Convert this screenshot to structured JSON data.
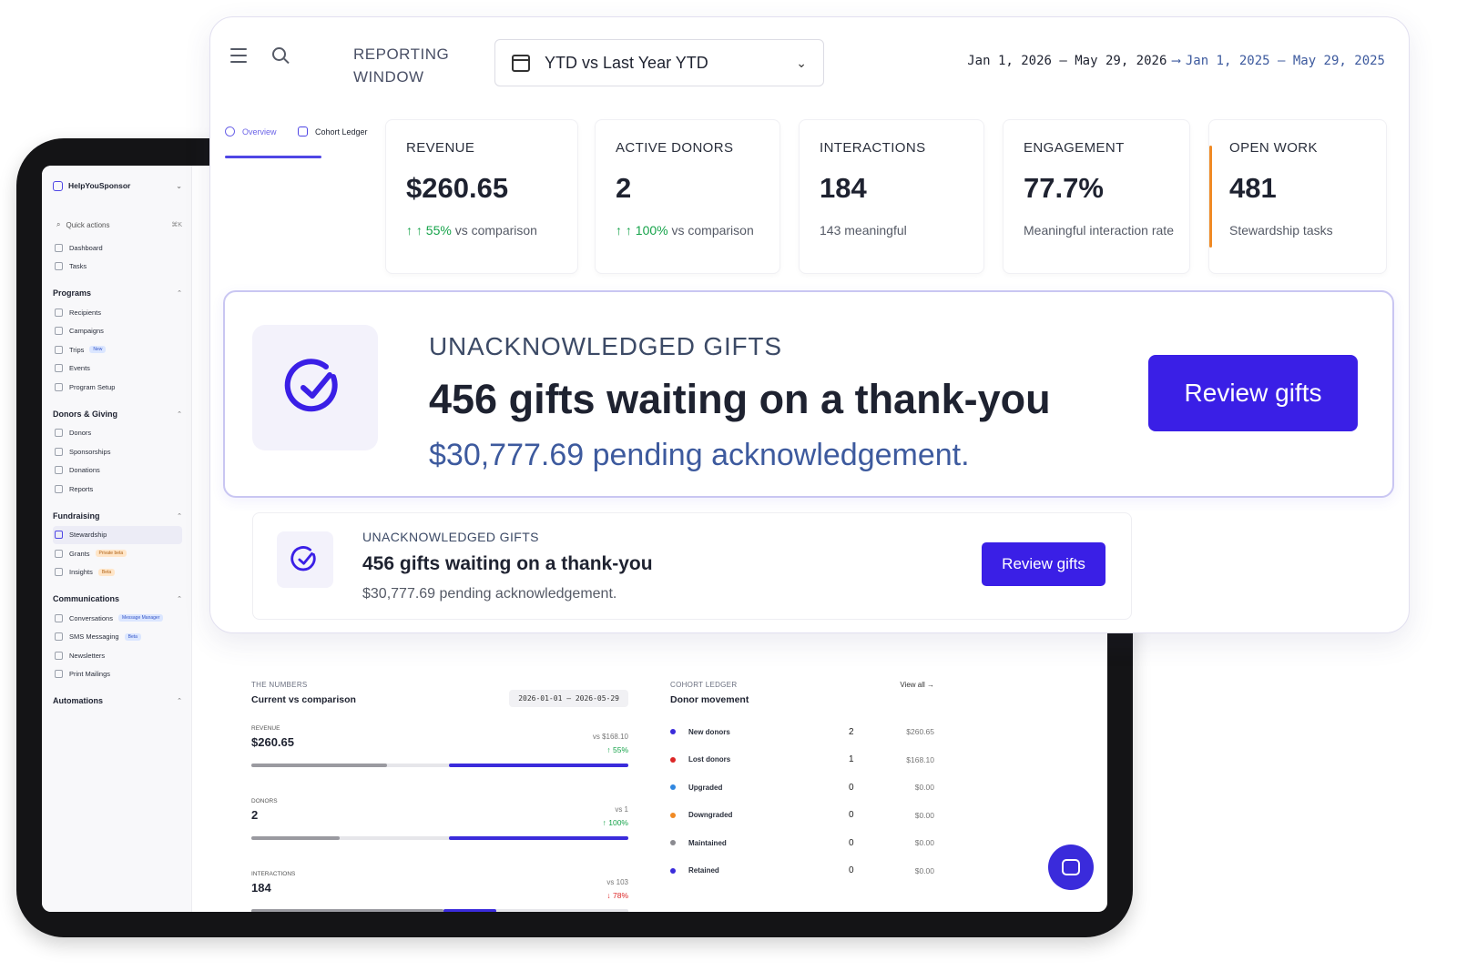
{
  "colors": {
    "accent": "#3a1fe6",
    "up": "#16a34a",
    "down": "#dc2626",
    "open_work_bar": "#f08a24"
  },
  "header": {
    "reporting_window_label": "REPORTING WINDOW",
    "selected_period": "YTD vs Last Year YTD",
    "current_range": "Jan 1, 2026 – May 29, 2026",
    "comparison_range": "Jan 1, 2025 – May 29, 2025"
  },
  "tabs": [
    {
      "label": "Overview",
      "icon": "check-circle-icon",
      "active": true
    },
    {
      "label": "Cohort Ledger",
      "icon": "ledger-icon",
      "active": false
    }
  ],
  "kpis": [
    {
      "label": "REVENUE",
      "value": "$260.65",
      "arrow": "↑ ↑",
      "change": "55%",
      "sub": "vs comparison"
    },
    {
      "label": "ACTIVE DONORS",
      "value": "2",
      "arrow": "↑ ↑",
      "change": "100%",
      "sub": "vs comparison"
    },
    {
      "label": "INTERACTIONS",
      "value": "184",
      "sub": "143 meaningful"
    },
    {
      "label": "ENGAGEMENT",
      "value": "77.7%",
      "sub": "Meaningful interaction rate"
    },
    {
      "label": "OPEN WORK",
      "value": "481",
      "sub": "Stewardship tasks"
    }
  ],
  "alert": {
    "label": "UNACKNOWLEDGED GIFTS",
    "title": "456 gifts waiting on a thank-you",
    "subtitle": "$30,777.69 pending acknowledgement.",
    "button": "Review gifts"
  },
  "sidebar": {
    "org": "HelpYouSponsor",
    "quick_actions": "Quick actions",
    "shortcut": "⌘K",
    "top_items": [
      {
        "label": "Dashboard"
      },
      {
        "label": "Tasks"
      }
    ],
    "sections": [
      {
        "title": "Programs",
        "items": [
          {
            "label": "Recipients"
          },
          {
            "label": "Campaigns"
          },
          {
            "label": "Trips",
            "badge": "New"
          },
          {
            "label": "Events"
          },
          {
            "label": "Program Setup"
          }
        ]
      },
      {
        "title": "Donors & Giving",
        "items": [
          {
            "label": "Donors"
          },
          {
            "label": "Sponsorships"
          },
          {
            "label": "Donations"
          },
          {
            "label": "Reports"
          }
        ]
      },
      {
        "title": "Fundraising",
        "items": [
          {
            "label": "Stewardship"
          },
          {
            "label": "Grants",
            "badge": "Private beta"
          },
          {
            "label": "Insights",
            "badge": "Beta"
          }
        ]
      },
      {
        "title": "Communications",
        "items": [
          {
            "label": "Conversations",
            "badge": "Message Manager"
          },
          {
            "label": "SMS Messaging",
            "badge": "Beta"
          },
          {
            "label": "Newsletters"
          },
          {
            "label": "Print Mailings"
          }
        ]
      },
      {
        "title": "Automations",
        "items": []
      }
    ]
  },
  "numbers": {
    "label": "THE NUMBERS",
    "title": "Current vs comparison",
    "range": "2026-01-01 – 2026-05-29",
    "metrics": [
      {
        "label": "REVENUE",
        "value": "$260.65",
        "vs": "vs $168.10",
        "change": "↑ 55%",
        "direction": "up",
        "current_fraction": 0.475,
        "previous_fraction": 0.36
      },
      {
        "label": "DONORS",
        "value": "2",
        "vs": "vs 1",
        "change": "↑ 100%",
        "direction": "up",
        "current_fraction": 0.475,
        "previous_fraction": 0.235
      },
      {
        "label": "INTERACTIONS",
        "value": "184",
        "vs": "vs 103",
        "change": "↓ 78%",
        "direction": "down",
        "current_fraction": 0.14,
        "previous_fraction": 0.51
      }
    ]
  },
  "cohort": {
    "label": "COHORT LEDGER",
    "title": "Donor movement",
    "view_all": "View all →",
    "rows": [
      {
        "name": "New donors",
        "count": "2",
        "amount": "$260.65",
        "color": "#3a2bdb"
      },
      {
        "name": "Lost donors",
        "count": "1",
        "amount": "$168.10",
        "color": "#dc2626"
      },
      {
        "name": "Upgraded",
        "count": "0",
        "amount": "$0.00",
        "color": "#2f86e0"
      },
      {
        "name": "Downgraded",
        "count": "0",
        "amount": "$0.00",
        "color": "#f08a24"
      },
      {
        "name": "Maintained",
        "count": "0",
        "amount": "$0.00",
        "color": "#8a8a90"
      },
      {
        "name": "Retained",
        "count": "0",
        "amount": "$0.00",
        "color": "#3a2bdb"
      }
    ]
  }
}
